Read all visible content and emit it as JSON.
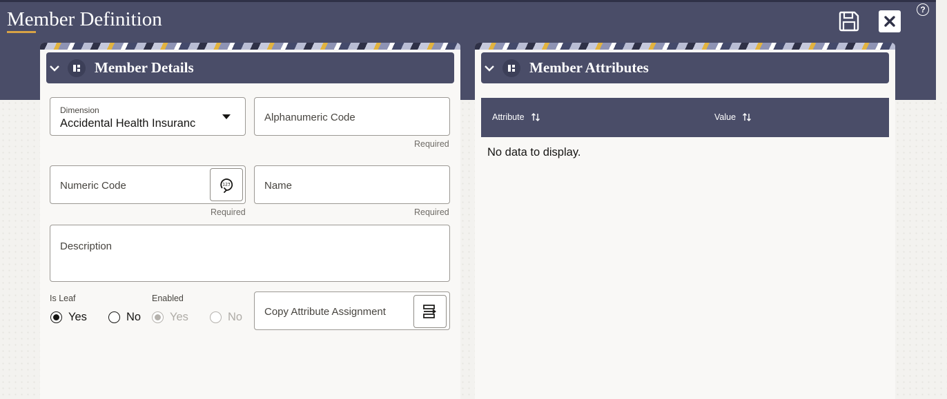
{
  "page": {
    "title": "Member Definition"
  },
  "toolbar": {
    "save_icon": "save-icon",
    "close_icon": "close-icon",
    "help_label": "?"
  },
  "member_details": {
    "title": "Member Details",
    "dimension": {
      "label": "Dimension",
      "value": "Accidental Health Insuranc"
    },
    "alphanumeric_code": {
      "placeholder": "Alphanumeric Code",
      "hint": "Required"
    },
    "numeric_code": {
      "placeholder": "Numeric Code",
      "hint": "Required"
    },
    "name": {
      "placeholder": "Name",
      "hint": "Required"
    },
    "description": {
      "placeholder": "Description"
    },
    "is_leaf": {
      "label": "Is Leaf",
      "options": [
        "Yes",
        "No"
      ],
      "selected": "Yes"
    },
    "enabled": {
      "label": "Enabled",
      "options": [
        "Yes",
        "No"
      ],
      "selected": "Yes",
      "disabled": true
    },
    "copy_attribute_assignment": {
      "placeholder": "Copy Attribute Assignment"
    }
  },
  "member_attributes": {
    "title": "Member Attributes",
    "columns": [
      "Attribute",
      "Value"
    ],
    "empty_text": "No data to display."
  },
  "colors": {
    "header": "#4a4d68",
    "accent": "#d8a345",
    "panel": "#f9f8f6"
  }
}
